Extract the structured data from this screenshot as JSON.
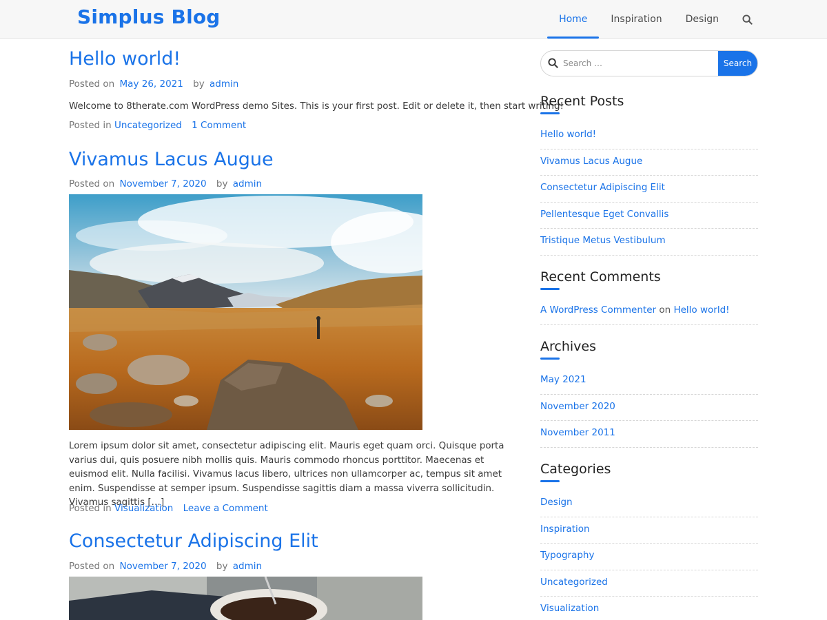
{
  "site": {
    "title": "Simplus Blog"
  },
  "nav": {
    "items": [
      {
        "label": "Home"
      },
      {
        "label": "Inspiration"
      },
      {
        "label": "Design"
      }
    ],
    "search_icon": "search-icon"
  },
  "posts": [
    {
      "title": "Hello world!",
      "posted_on_label": "Posted on",
      "date": "May 26, 2021",
      "by_label": "by",
      "author": "admin",
      "excerpt": "Welcome to 8therate.com WordPress demo Sites. This is your first post. Edit or delete it, then start writing!",
      "posted_in_label": "Posted in",
      "category": "Uncategorized",
      "comment_link": "1 Comment"
    },
    {
      "title": "Vivamus Lacus Augue",
      "posted_on_label": "Posted on",
      "date": "November 7, 2020",
      "by_label": "by",
      "author": "admin",
      "excerpt": "Lorem ipsum dolor sit amet, consectetur adipiscing elit. Mauris eget quam orci. Quisque porta varius dui, quis posuere nibh mollis quis. Mauris commodo rhoncus porttitor. Maecenas et euismod elit. Nulla facilisi. Vivamus lacus libero, ultrices non ullamcorper ac, tempus sit amet enim. Suspendisse at semper ipsum. Suspendisse sagittis diam a massa viverra sollicitudin. Vivamus sagittis […]",
      "posted_in_label": "Posted in",
      "category": "Visualization",
      "comment_link": "Leave a Comment"
    },
    {
      "title": "Consectetur Adipiscing Elit",
      "posted_on_label": "Posted on",
      "date": "November 7, 2020",
      "by_label": "by",
      "author": "admin"
    }
  ],
  "sidebar": {
    "search": {
      "placeholder": "Search …",
      "button_label": "Search"
    },
    "recent_posts": {
      "title": "Recent Posts",
      "items": [
        "Hello world!",
        "Vivamus Lacus Augue",
        "Consectetur Adipiscing Elit",
        "Pellentesque Eget Convallis",
        "Tristique Metus Vestibulum"
      ]
    },
    "recent_comments": {
      "title": "Recent Comments",
      "items": [
        {
          "author": "A WordPress Commenter",
          "on_label": "on",
          "post": "Hello world!"
        }
      ]
    },
    "archives": {
      "title": "Archives",
      "items": [
        "May 2021",
        "November 2020",
        "November 2011"
      ]
    },
    "categories": {
      "title": "Categories",
      "items": [
        "Design",
        "Inspiration",
        "Typography",
        "Uncategorized",
        "Visualization"
      ]
    }
  },
  "colors": {
    "accent": "#1a73e8",
    "header_bg": "#f7f7f7",
    "text": "#3a3a3a",
    "muted": "#777777"
  }
}
